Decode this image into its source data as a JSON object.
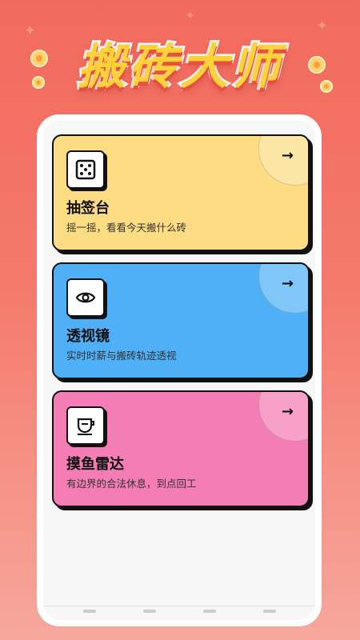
{
  "app": {
    "title": "搬砖大师"
  },
  "cards": [
    {
      "title": "抽签台",
      "subtitle": "摇一摇，看看今天搬什么砖",
      "icon": "dice-icon",
      "color": "#fddc83"
    },
    {
      "title": "透视镜",
      "subtitle": "实时时薪与搬砖轨迹透视",
      "icon": "eye-icon",
      "color": "#4fb0f7"
    },
    {
      "title": "摸鱼雷达",
      "subtitle": "有边界的合法休息，到点回工",
      "icon": "cup-icon",
      "color": "#f47db5"
    }
  ],
  "arrow_glyph": "→",
  "colors": {
    "background": "#f26a5e",
    "title_fill": "#ffd23a",
    "card_border": "#111111"
  }
}
